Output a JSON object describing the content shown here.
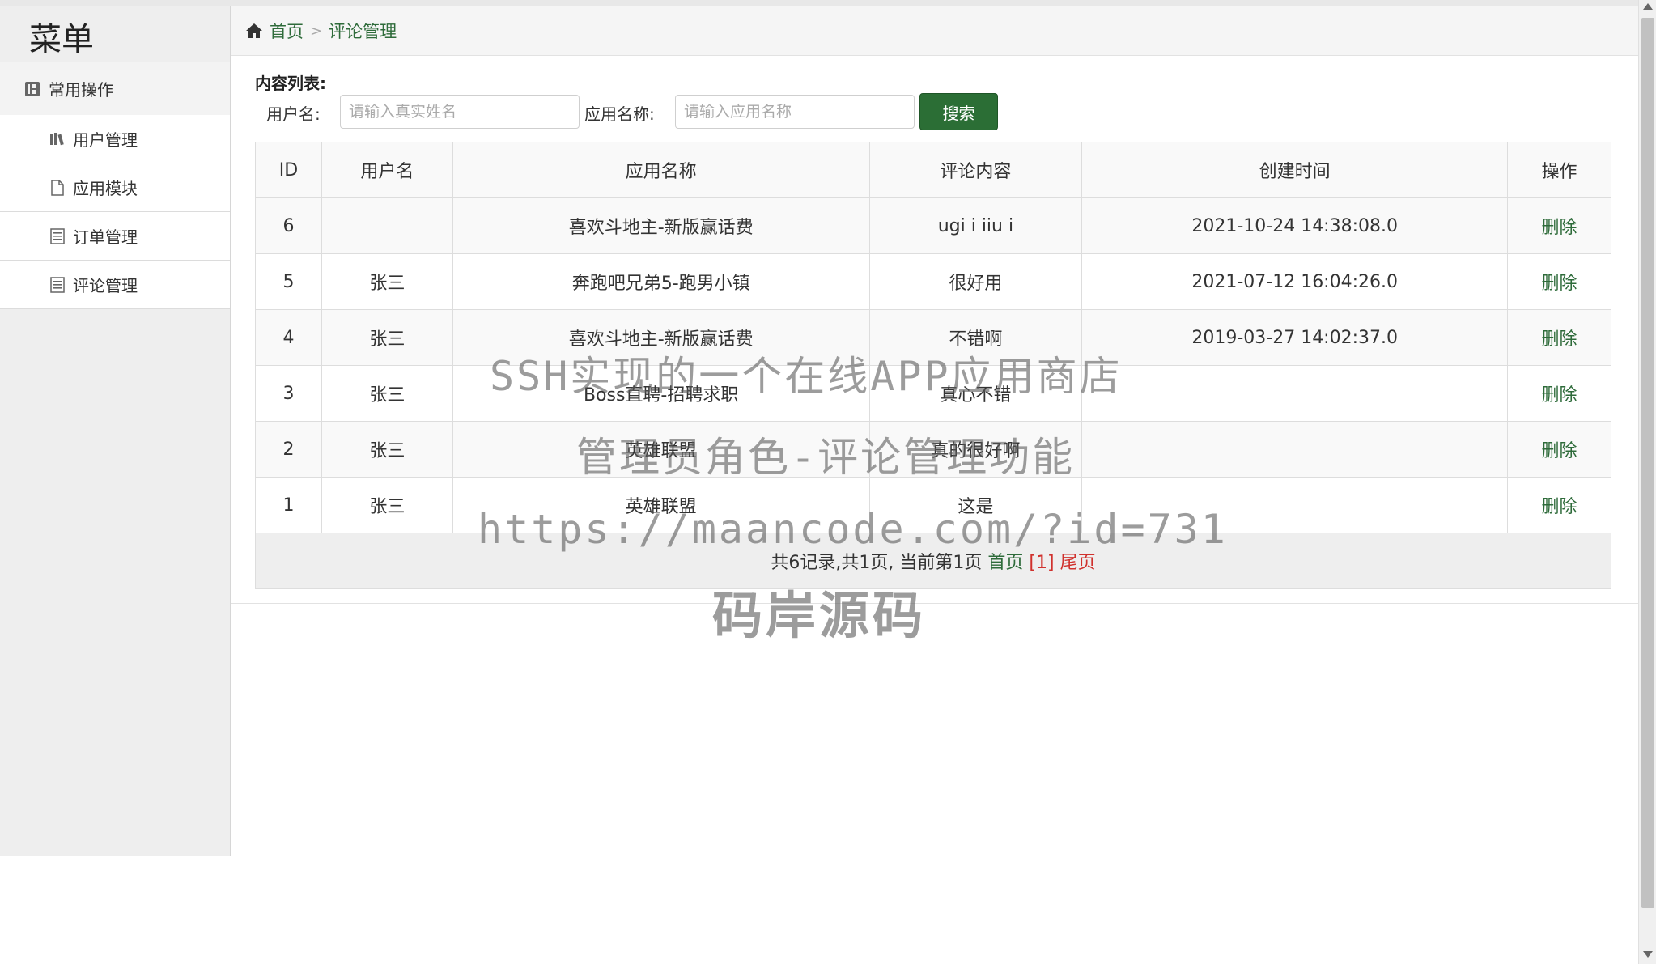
{
  "sidebar": {
    "title": "菜单",
    "group_label": "常用操作",
    "items": [
      {
        "label": "用户管理",
        "icon": "books-icon"
      },
      {
        "label": "应用模块",
        "icon": "file-icon"
      },
      {
        "label": "订单管理",
        "icon": "list-icon"
      },
      {
        "label": "评论管理",
        "icon": "list-icon"
      }
    ]
  },
  "breadcrumb": {
    "home": "首页",
    "current": "评论管理",
    "separator": ">"
  },
  "filter": {
    "title": "内容列表:",
    "user_label": "用户名:",
    "user_placeholder": "请输入真实姓名",
    "app_label": "应用名称:",
    "app_placeholder": "请输入应用名称",
    "search_button": "搜索"
  },
  "table": {
    "headers": [
      "ID",
      "用户名",
      "应用名称",
      "评论内容",
      "创建时间",
      "操作"
    ],
    "rows": [
      {
        "id": "6",
        "user": "",
        "app": "喜欢斗地主-新版赢话费",
        "content": "ugi i iiu i",
        "time": "2021-10-24 14:38:08.0",
        "action": "删除"
      },
      {
        "id": "5",
        "user": "张三",
        "app": "奔跑吧兄弟5-跑男小镇",
        "content": "很好用",
        "time": "2021-07-12 16:04:26.0",
        "action": "删除"
      },
      {
        "id": "4",
        "user": "张三",
        "app": "喜欢斗地主-新版赢话费",
        "content": "不错啊",
        "time": "2019-03-27 14:02:37.0",
        "action": "删除"
      },
      {
        "id": "3",
        "user": "张三",
        "app": "Boss直聘-招聘求职",
        "content": "真心不错",
        "time": "",
        "action": "删除"
      },
      {
        "id": "2",
        "user": "张三",
        "app": "英雄联盟",
        "content": "真的很好啊",
        "time": "",
        "action": "删除"
      },
      {
        "id": "1",
        "user": "张三",
        "app": "英雄联盟",
        "content": "这是",
        "time": "",
        "action": "删除"
      }
    ]
  },
  "pager": {
    "summary": "共6记录,共1页, 当前第1页",
    "first": "首页",
    "current": "[1]",
    "last": "尾页"
  },
  "watermark": {
    "line1": "SSH实现的一个在线APP应用商店",
    "line2": "管理员角色-评论管理功能",
    "line3": "https://maancode.com/?id=731",
    "line4": "码岸源码"
  },
  "colors": {
    "accent": "#2b6e35",
    "link": "#2e6b3a",
    "pager_red": "#d0312d"
  }
}
